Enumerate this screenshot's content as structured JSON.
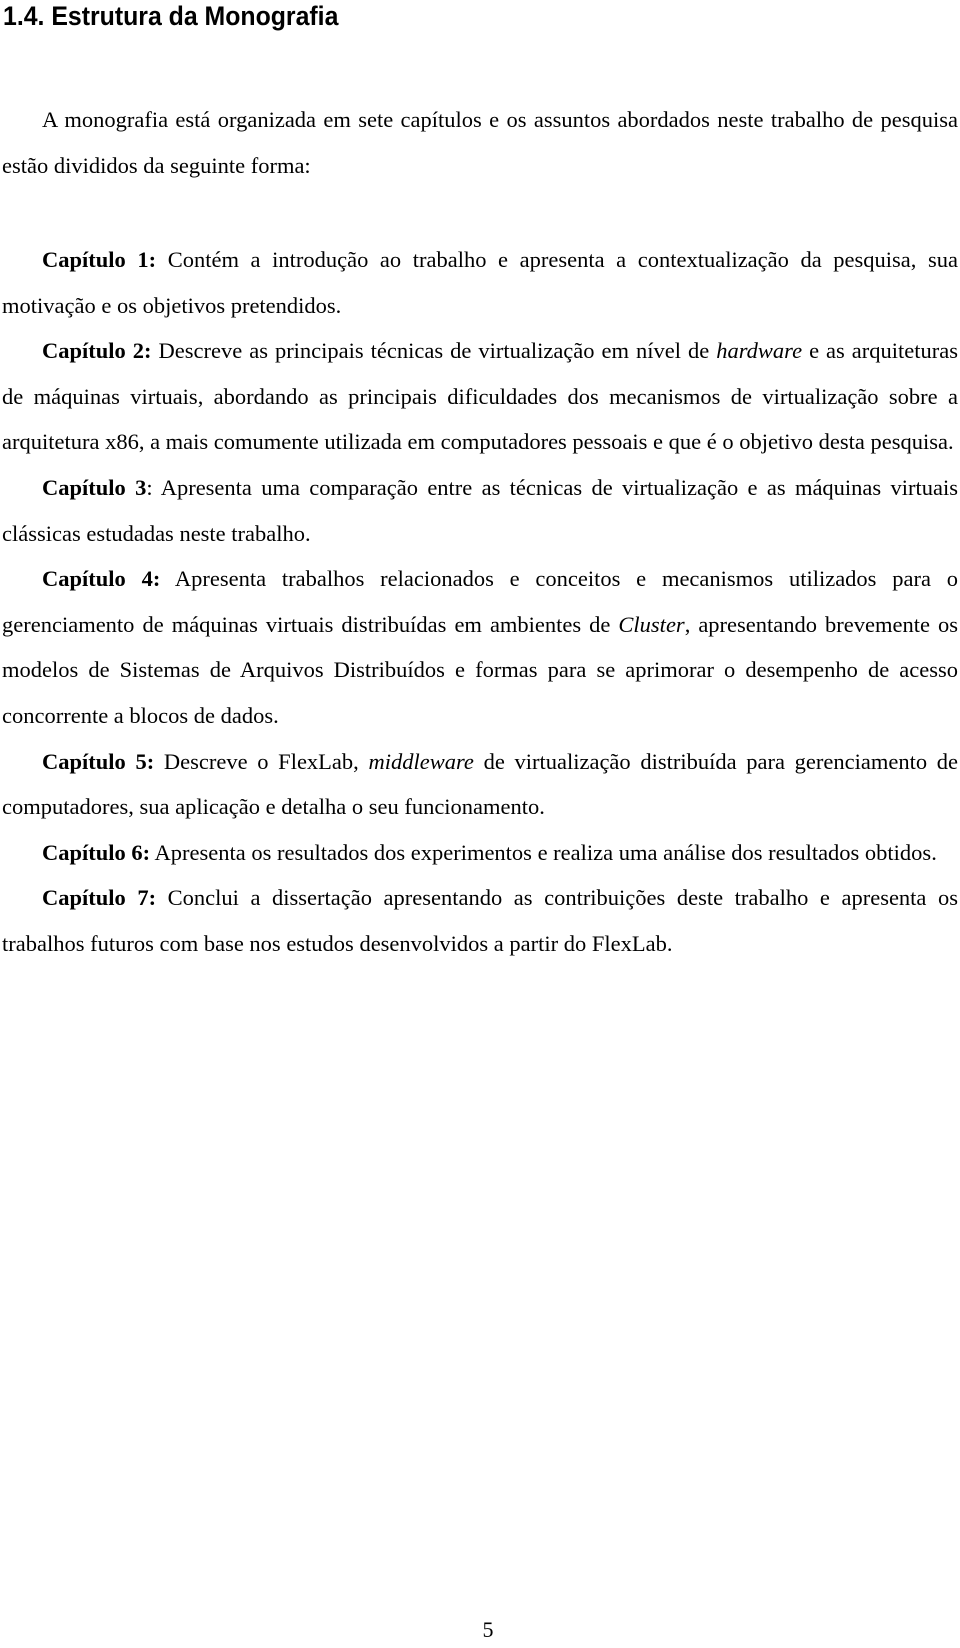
{
  "document": {
    "section_heading": "1.4. Estrutura da Monografia",
    "intro_paragraph": "A monografia está organizada em sete capítulos e os assuntos abordados neste trabalho de pesquisa estão divididos da seguinte forma:",
    "chapters": [
      {
        "label": "Capítulo 1:",
        "segments": [
          {
            "text": " Contém a introdução ao trabalho e apresenta a contextualização da pesquisa, sua motivação e os objetivos pretendidos.",
            "style": "normal"
          }
        ]
      },
      {
        "label": "Capítulo 2:",
        "segments": [
          {
            "text": " Descreve as principais técnicas de virtualização em nível de ",
            "style": "normal"
          },
          {
            "text": "hardware",
            "style": "italic"
          },
          {
            "text": " e as arquiteturas de máquinas virtuais, abordando as principais dificuldades dos mecanismos de virtualização sobre a arquitetura x86, a mais comumente utilizada em computadores pessoais e que é o objetivo desta pesquisa.",
            "style": "normal"
          }
        ]
      },
      {
        "label": "Capítulo 3",
        "segments": [
          {
            "text": ": Apresenta uma comparação entre as técnicas de virtualização e as máquinas virtuais clássicas estudadas neste trabalho.",
            "style": "normal"
          }
        ]
      },
      {
        "label": "Capítulo 4:",
        "segments": [
          {
            "text": " Apresenta trabalhos relacionados e conceitos e mecanismos utilizados para o gerenciamento de máquinas virtuais distribuídas em ambientes de ",
            "style": "normal"
          },
          {
            "text": "Cluster",
            "style": "italic"
          },
          {
            "text": ", apresentando brevemente os modelos de Sistemas de Arquivos Distribuídos e formas para se aprimorar o desempenho de acesso concorrente a blocos de dados.",
            "style": "normal"
          }
        ]
      },
      {
        "label": "Capítulo 5:",
        "segments": [
          {
            "text": " Descreve o FlexLab, ",
            "style": "normal"
          },
          {
            "text": "middleware",
            "style": "italic"
          },
          {
            "text": " de virtualização distribuída para gerenciamento de computadores, sua aplicação e detalha o seu funcionamento.",
            "style": "normal"
          }
        ]
      },
      {
        "label": "Capítulo 6:",
        "segments": [
          {
            "text": " Apresenta os resultados dos experimentos e realiza uma análise dos resultados obtidos.",
            "style": "normal"
          }
        ]
      },
      {
        "label": "Capítulo 7:",
        "segments": [
          {
            "text": " Conclui a dissertação apresentando as contribuições deste trabalho e apresenta os trabalhos futuros com base nos estudos desenvolvidos a partir do FlexLab.",
            "style": "normal"
          }
        ]
      }
    ],
    "page_number": "5"
  }
}
